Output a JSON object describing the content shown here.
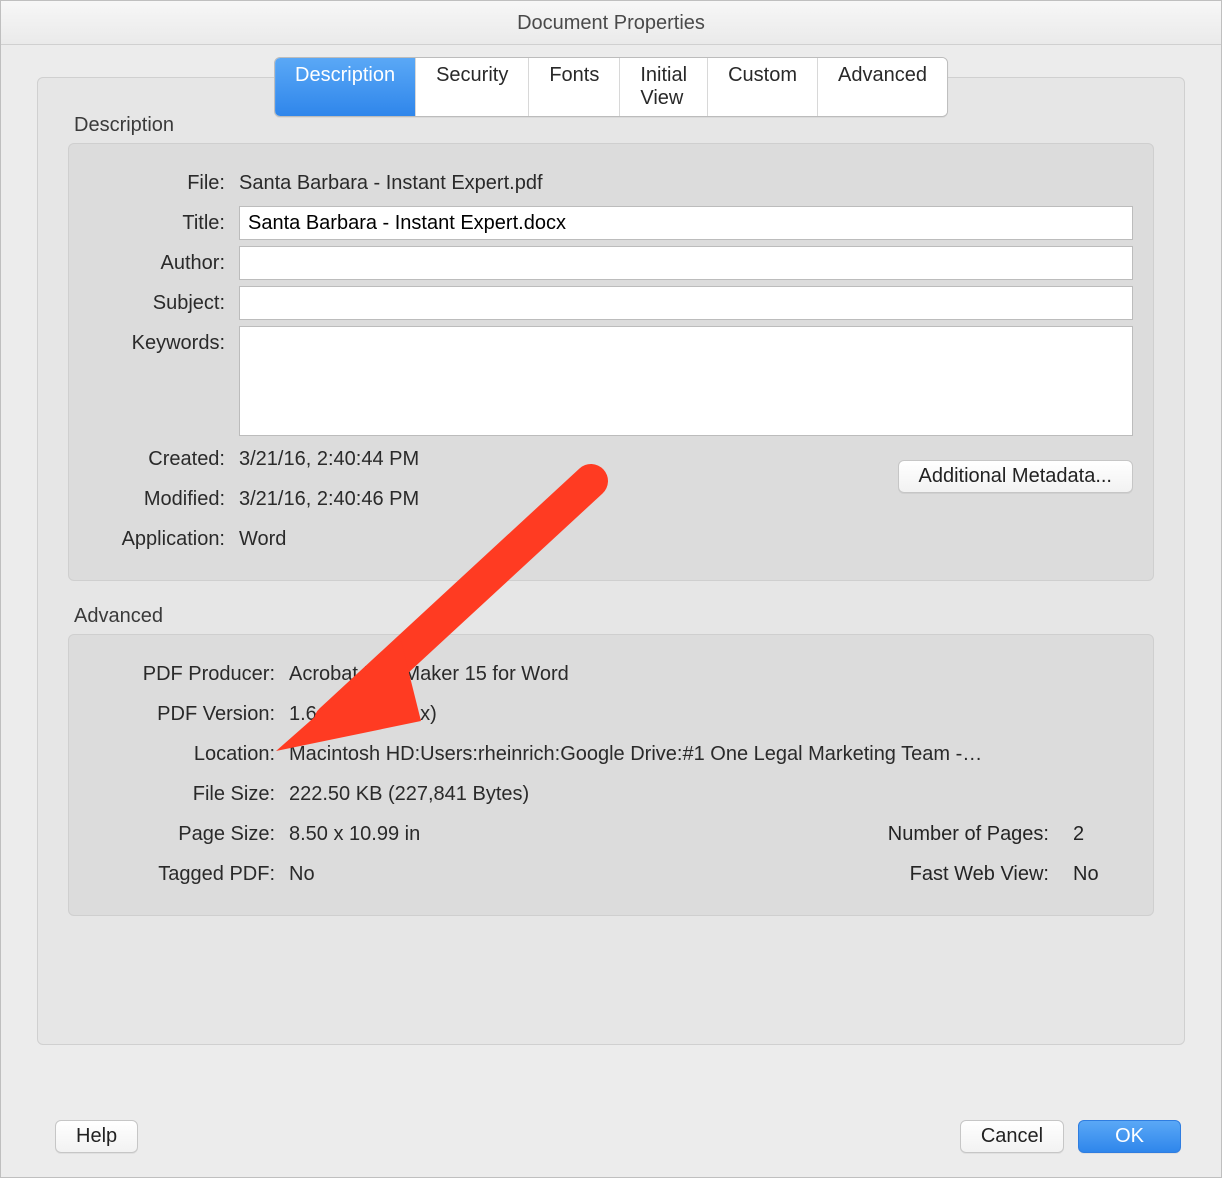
{
  "window": {
    "title": "Document Properties"
  },
  "tabs": {
    "description": "Description",
    "security": "Security",
    "fonts": "Fonts",
    "initial_view": "Initial View",
    "custom": "Custom",
    "advanced": "Advanced"
  },
  "description_group": {
    "heading": "Description",
    "labels": {
      "file": "File:",
      "title": "Title:",
      "author": "Author:",
      "subject": "Subject:",
      "keywords": "Keywords:",
      "created": "Created:",
      "modified": "Modified:",
      "application": "Application:"
    },
    "values": {
      "file": "Santa Barbara - Instant Expert.pdf",
      "title": "Santa Barbara - Instant Expert.docx",
      "author": "",
      "subject": "",
      "keywords": "",
      "created": "3/21/16, 2:40:44 PM",
      "modified": "3/21/16, 2:40:46 PM",
      "application": "Word"
    },
    "metadata_button": "Additional Metadata..."
  },
  "advanced_group": {
    "heading": "Advanced",
    "labels": {
      "pdf_producer": "PDF Producer:",
      "pdf_version": "PDF Version:",
      "location": "Location:",
      "file_size": "File Size:",
      "page_size": "Page Size:",
      "num_pages": "Number of Pages:",
      "tagged_pdf": "Tagged PDF:",
      "fast_web_view": "Fast Web View:"
    },
    "values": {
      "pdf_producer": "Acrobat PDFMaker 15 for Word",
      "pdf_version": "1.6 (Acrobat 7.x)",
      "location": "Macintosh HD:Users:rheinrich:Google Drive:#1 One Legal Marketing Team -…",
      "file_size": "222.50 KB (227,841 Bytes)",
      "page_size": "8.50 x 10.99 in",
      "num_pages": "2",
      "tagged_pdf": "No",
      "fast_web_view": "No"
    }
  },
  "footer": {
    "help": "Help",
    "cancel": "Cancel",
    "ok": "OK"
  },
  "annotation": {
    "arrow_color": "#ff3b22"
  }
}
